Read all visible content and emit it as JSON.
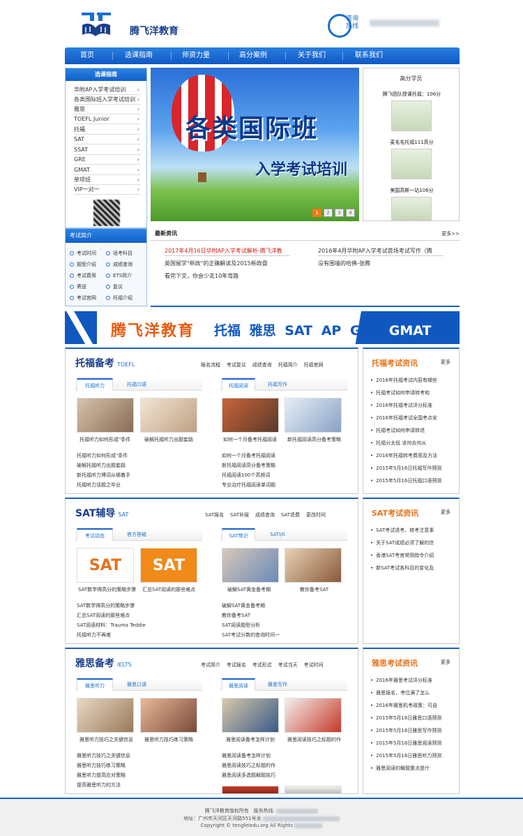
{
  "header": {
    "brand": "腾飞洋教育",
    "hotline_label_1": "咨询",
    "hotline_label_2": "热线"
  },
  "nav": [
    "首页",
    "选课指南",
    "师资力量",
    "高分案例",
    "关于我们",
    "联系我们"
  ],
  "sidebar": {
    "title": "选课指南",
    "items": [
      "华附AP入学考试培训",
      "各类国际班入学考试培训",
      "雅思",
      "TOEFL Junior",
      "托福",
      "SAT",
      "SSAT",
      "GRE",
      "GMAT",
      "单项班",
      "VIP一对一"
    ]
  },
  "banner": {
    "line1": "各类国际班",
    "line2": "入学考试培训",
    "pages": [
      "1",
      "2",
      "3",
      "4"
    ],
    "active_page": 1
  },
  "stars": {
    "title": "高分学员",
    "items": [
      "腾飞团队授课托福：106分",
      "麦毛毛托福111高分",
      "美国高斯一站106分"
    ]
  },
  "intro": {
    "title": "考试简介",
    "items": [
      "考试时间",
      "适考科目",
      "题型介绍",
      "成绩查询",
      "考试费用",
      "ETS简介",
      "寄送",
      "复议",
      "考试官网",
      "托福介绍"
    ]
  },
  "news": {
    "title": "最新资讯",
    "more": "更多>>",
    "items": [
      "2017年4月16日华附AP入学考试解析-腾飞洋教",
      "2016年4月华附AP入学考试首场考试写作（腾",
      "英国留学\"新政\"的正确解读及2015新政盘",
      "没有围墙的哈佛-张腾",
      "看完下文，你会少走10年弯路"
    ]
  },
  "adbar": {
    "brand": "腾飞洋教育",
    "tags": "托福 雅思 SAT AP GRE",
    "gmat": "GMAT"
  },
  "toefl": {
    "title": "托福备考",
    "sub": "TOEFL",
    "links": [
      "报名流程",
      "考试复议",
      "成绩查询",
      "托福简介",
      "托福官网"
    ],
    "left_tabs": [
      "托福听力",
      "托福口语"
    ],
    "right_tabs": [
      "托福阅读",
      "托福写作"
    ],
    "thumb_caps": [
      "托福听力如何形成\"条件",
      "破解托福听力出题套路",
      "如何一个月备考托福阅读",
      "新托福阅读高分备考策略"
    ],
    "left_list": [
      "托福听力如何形成\"条件",
      "破解托福听力出题套路",
      "新托福听力博词从哪着手",
      "托福听力话题之毕业"
    ],
    "right_list": [
      "如何一个月备考托福阅读",
      "新托福阅读高分备考策略",
      "托福阅读100个高频词",
      "专业治疗托福阅读单词题"
    ]
  },
  "toefl_news": {
    "title": "托福考试资讯",
    "more": "更多",
    "items": [
      "2016年托福考试内容有哪些",
      "托福考试如何申请转考和",
      "2016年托福考试评分标准",
      "2016年托福考试全国考点安",
      "托福考试如何申请转退",
      "托福分太低 该何去何从",
      "2016年托福转考费用及方法",
      "2015年5月16日托福写作预测",
      "2015年5月16日托福口语预测"
    ]
  },
  "sat": {
    "title": "SAT辅导",
    "sub": "SAT",
    "links": [
      "SAT报名",
      "SAT补报",
      "成绩查询",
      "SAT退费",
      "更改时间"
    ],
    "left_tabs": [
      "考试动态",
      "官方答疑"
    ],
    "right_tabs": [
      "SAT常识",
      "SATI/II"
    ],
    "thumb_caps": [
      "SAT数学得高分的策略步骤",
      "汇总SAT阅读的那些难点",
      "破解SAT黄金备考期",
      "教你备考SAT"
    ],
    "left_list": [
      "SAT数学得高分的策略步骤",
      "汇总SAT阅读的那些难点",
      "SAT阅读材料：Trauma Teddie",
      "托福听力不再难"
    ],
    "right_list": [
      "破解SAT黄金备考期",
      "教你备考SAT",
      "SAT阅读题型分析",
      "SAT考试分数的查询时间一"
    ]
  },
  "sat_news": {
    "title": "SAT考试资讯",
    "more": "更多",
    "items": [
      "SAT考试退考、转考注意事",
      "关于SAT成绩必须了解的信",
      "香港SAT考官常用指令介绍",
      "新SAT考试各科目的变化及"
    ]
  },
  "ielts": {
    "title": "雅思备考",
    "sub": "IELTS",
    "links": [
      "考试简介",
      "考试报名",
      "考试形式",
      "考试当天",
      "考试时间"
    ],
    "left_tabs": [
      "雅思听力",
      "雅思口语"
    ],
    "right_tabs": [
      "雅思阅读",
      "雅思写作"
    ],
    "thumb_caps": [
      "雅思听力技巧之关键信息",
      "雅思听力技巧练习策略",
      "雅思阅读备考怎样计划",
      "雅思阅读技巧之标题的作"
    ],
    "left_list": [
      "雅思听力技巧之关键信息",
      "雅思听力技巧练习策略",
      "雅思听力提高应对策略",
      "提高雅思听力的方法"
    ],
    "right_list": [
      "雅思阅读备考怎样计划",
      "雅思阅读技巧之标题的作",
      "雅思阅读多选题解题技巧"
    ]
  },
  "ielts_news": {
    "title": "雅思考试资讯",
    "more": "更多",
    "items": [
      "2016年雅思考试评分标准",
      "雅思报名，考位满了怎么",
      "2016年雅思机考政策：可自",
      "2015年5月16日雅思口语预测",
      "2015年5月16日雅思写作预测",
      "2015年5月16日雅思阅读预测",
      "2015年5月16日雅思听力预测",
      "雅思阅读的解题重点是什"
    ]
  },
  "footer": {
    "line1a": "腾飞洋教育版权所有",
    "line1b": "服务热线:",
    "line2": "地址：广州市天河区天河路551号龙",
    "line3": "Copyright © tengfeiedu.org All Rights"
  }
}
